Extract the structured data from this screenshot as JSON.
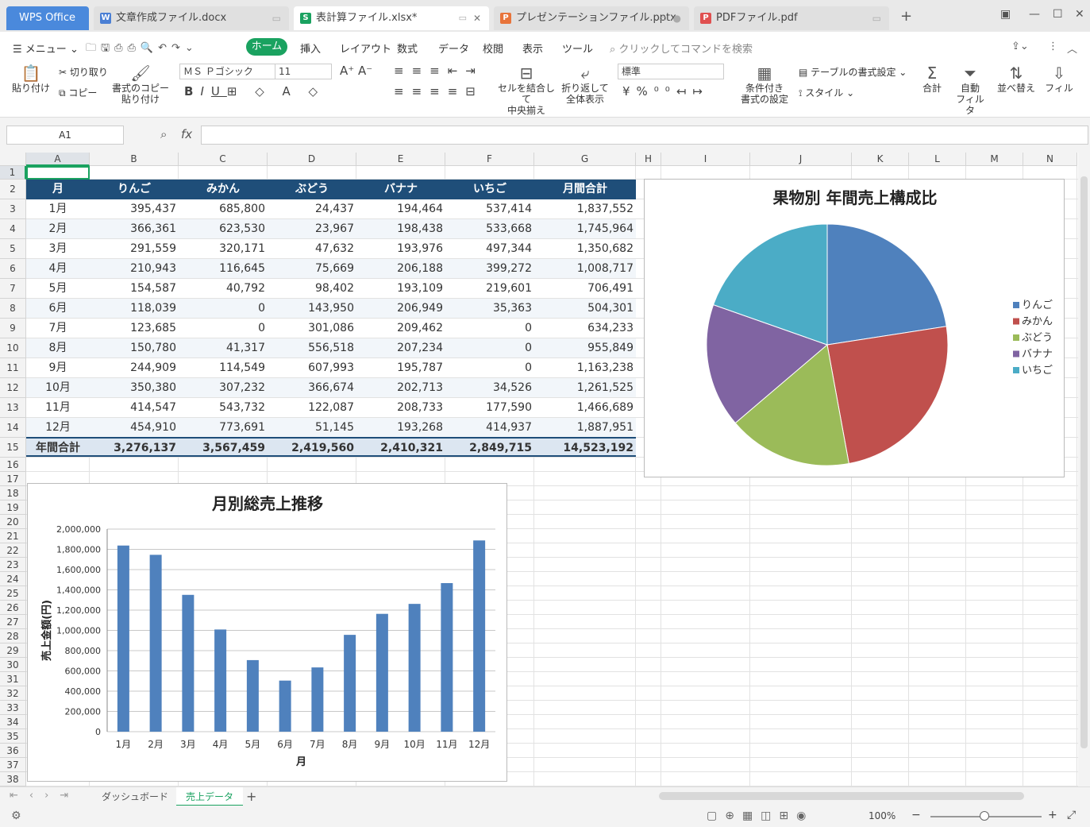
{
  "titlebar": {
    "app_tab": "WPS Office",
    "tabs": [
      {
        "label": "文章作成ファイル.docx",
        "icon": "W",
        "color": "#4a7fd4"
      },
      {
        "label": "表計算ファイル.xlsx*",
        "icon": "S",
        "color": "#1aa260"
      },
      {
        "label": "プレゼンテーションファイル.pptx",
        "icon": "P",
        "color": "#e8743b"
      },
      {
        "label": "PDFファイル.pdf",
        "icon": "P",
        "color": "#e05050"
      }
    ],
    "new_tab": "+"
  },
  "menubar": {
    "menu_label": "メニュー",
    "items": [
      "ホーム",
      "挿入",
      "レイアウト",
      "数式",
      "データ",
      "校閲",
      "表示",
      "ツール"
    ],
    "search_placeholder": "クリックしてコマンドを検索"
  },
  "ribbon": {
    "paste": "貼り付け",
    "cut": "切り取り",
    "copy": "コピー",
    "format_painter": "書式のコピー",
    "format_painter2": "貼り付け",
    "font_name": "ＭＳ Ｐゴシック",
    "font_size": "11",
    "merge": "セルを結合して",
    "merge2": "中央揃え",
    "wrap": "折り返して",
    "wrap2": "全体表示",
    "number_format": "標準",
    "cond_format": "条件付き",
    "cond_format2": "書式の設定",
    "table_format": "テーブルの書式設定",
    "style": "スタイル",
    "sum": "合計",
    "autofilter": "自動",
    "autofilter2": "フィルタ",
    "sort": "並べ替え",
    "fill": "フィル"
  },
  "formulabar": {
    "cell_ref": "A1",
    "fx": "fx",
    "value": ""
  },
  "columns": [
    "A",
    "B",
    "C",
    "D",
    "E",
    "F",
    "G",
    "H",
    "I",
    "J",
    "K",
    "L",
    "M",
    "N"
  ],
  "rows": [
    "1",
    "2",
    "3",
    "4",
    "5",
    "6",
    "7",
    "8",
    "9",
    "10",
    "11",
    "12",
    "13",
    "14",
    "15",
    "16",
    "17",
    "18",
    "19",
    "20",
    "21",
    "22",
    "23",
    "24",
    "25",
    "26",
    "27",
    "28",
    "29",
    "30",
    "31",
    "32",
    "33",
    "34",
    "35",
    "36",
    "37",
    "38"
  ],
  "table": {
    "headers": [
      "月",
      "りんご",
      "みかん",
      "ぶどう",
      "バナナ",
      "いちご",
      "月間合計"
    ],
    "rows": [
      [
        "1月",
        "395,437",
        "685,800",
        "24,437",
        "194,464",
        "537,414",
        "1,837,552"
      ],
      [
        "2月",
        "366,361",
        "623,530",
        "23,967",
        "198,438",
        "533,668",
        "1,745,964"
      ],
      [
        "3月",
        "291,559",
        "320,171",
        "47,632",
        "193,976",
        "497,344",
        "1,350,682"
      ],
      [
        "4月",
        "210,943",
        "116,645",
        "75,669",
        "206,188",
        "399,272",
        "1,008,717"
      ],
      [
        "5月",
        "154,587",
        "40,792",
        "98,402",
        "193,109",
        "219,601",
        "706,491"
      ],
      [
        "6月",
        "118,039",
        "0",
        "143,950",
        "206,949",
        "35,363",
        "504,301"
      ],
      [
        "7月",
        "123,685",
        "0",
        "301,086",
        "209,462",
        "0",
        "634,233"
      ],
      [
        "8月",
        "150,780",
        "41,317",
        "556,518",
        "207,234",
        "0",
        "955,849"
      ],
      [
        "9月",
        "244,909",
        "114,549",
        "607,993",
        "195,787",
        "0",
        "1,163,238"
      ],
      [
        "10月",
        "350,380",
        "307,232",
        "366,674",
        "202,713",
        "34,526",
        "1,261,525"
      ],
      [
        "11月",
        "414,547",
        "543,732",
        "122,087",
        "208,733",
        "177,590",
        "1,466,689"
      ],
      [
        "12月",
        "454,910",
        "773,691",
        "51,145",
        "193,268",
        "414,937",
        "1,887,951"
      ]
    ],
    "total": [
      "年間合計",
      "3,276,137",
      "3,567,459",
      "2,419,560",
      "2,410,321",
      "2,849,715",
      "14,523,192"
    ]
  },
  "chart_data": [
    {
      "type": "pie",
      "title": "果物別 年間売上構成比",
      "categories": [
        "りんご",
        "みかん",
        "ぶどう",
        "バナナ",
        "いちご"
      ],
      "values": [
        3276137,
        3567459,
        2419560,
        2410321,
        2849715
      ],
      "colors": [
        "#4f81bd",
        "#c0504d",
        "#9bbb59",
        "#8064a2",
        "#4bacc6"
      ],
      "legend": "right"
    },
    {
      "type": "bar",
      "title": "月別総売上推移",
      "xlabel": "月",
      "ylabel": "売上金額(円)",
      "categories": [
        "1月",
        "2月",
        "3月",
        "4月",
        "5月",
        "6月",
        "7月",
        "8月",
        "9月",
        "10月",
        "11月",
        "12月"
      ],
      "values": [
        1837552,
        1745964,
        1350682,
        1008717,
        706491,
        504301,
        634233,
        955849,
        1163238,
        1261525,
        1466689,
        1887951
      ],
      "ylim": [
        0,
        2000000
      ],
      "yticks": [
        "0",
        "200,000",
        "400,000",
        "600,000",
        "800,000",
        "1,000,000",
        "1,200,000",
        "1,400,000",
        "1,600,000",
        "1,800,000",
        "2,000,000"
      ],
      "color": "#4f81bd",
      "grid": true
    }
  ],
  "sheets": {
    "tabs": [
      "ダッシュボード",
      "売上データ"
    ],
    "active": "売上データ",
    "add": "+"
  },
  "status": {
    "zoom": "100%"
  }
}
